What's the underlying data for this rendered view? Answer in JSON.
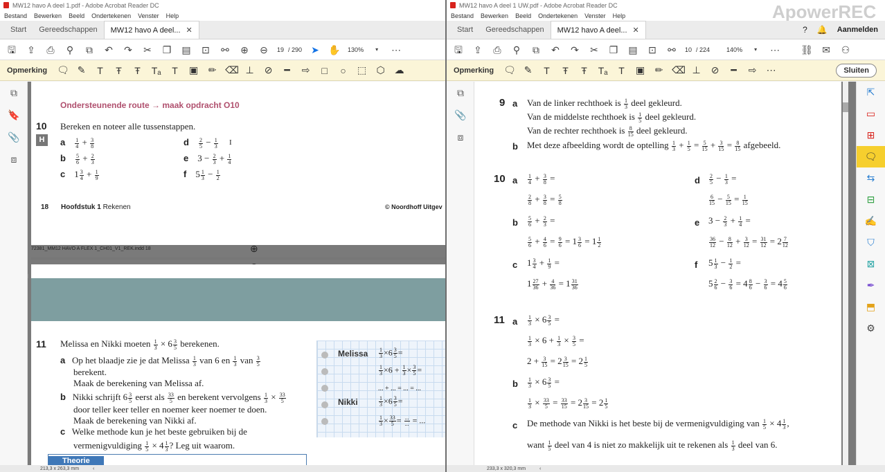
{
  "left": {
    "title": "MW12 havo A deel 1.pdf - Adobe Acrobat Reader DC",
    "menu": [
      "Bestand",
      "Bewerken",
      "Beeld",
      "Ondertekenen",
      "Venster",
      "Help"
    ],
    "tabs": {
      "start": "Start",
      "tools": "Gereedschappen",
      "doc": "MW12 havo A deel..."
    },
    "page_current": "19",
    "page_total": "/ 290",
    "zoom": "130%",
    "annot_label": "Opmerking",
    "status": "213,3 x 263,3 mm",
    "content": {
      "route": "Ondersteunende route → maak opdracht O10",
      "q10_num": "10",
      "q10_text": "Bereken en noteer alle tussenstappen.",
      "badge": "H",
      "a": "a",
      "b": "b",
      "c": "c",
      "d": "d",
      "e": "e",
      "f": "f",
      "footer_page": "18",
      "footer_chapter": "Hoofdstuk 1",
      "footer_chapter_rest": "Rekenen",
      "footer_copy": "© Noordhoff Uitgev",
      "printline": "72381_MM12 HAVO A FLEX 1_CH01_V1_REK.indd   18",
      "q11_num": "11",
      "q11_text_pre": "Melissa en Nikki moeten",
      "q11_text_post": "berekenen.",
      "q11a_1": "Op het blaadje zie je dat Melissa",
      "q11a_2": "van 6 en",
      "q11a_3": "van",
      "q11a_4": "berekent.",
      "q11a_5": "Maak de berekening van Melissa af.",
      "q11b_1": "Nikki schrijft",
      "q11b_2": "eerst als",
      "q11b_3": "en berekent vervolgens",
      "q11b_4": "door teller keer teller en noemer keer noemer te doen.",
      "q11b_5": "Maak de berekening van Nikki af.",
      "q11c_1": "Welke methode kun je het beste gebruiken bij de",
      "q11c_2": "vermenigvuldiging",
      "q11c_3": "? Leg uit waarom.",
      "note_melissa": "Melissa",
      "note_nikki": "Nikki",
      "note_dots": "... + ... = ... = ...",
      "theorie": "Theorie"
    }
  },
  "right": {
    "title": "MW12 havo A deel 1 UW.pdf - Adobe Acrobat Reader DC",
    "watermark": "ApowerREC",
    "menu": [
      "Bestand",
      "Bewerken",
      "Beeld",
      "Ondertekenen",
      "Venster",
      "Help"
    ],
    "tabs": {
      "start": "Start",
      "tools": "Gereedschappen",
      "doc": "MW12 havo A deel..."
    },
    "signin": "Aanmelden",
    "page_current": "10",
    "page_total": "/ 224",
    "zoom": "140%",
    "annot_label": "Opmerking",
    "close_label": "Sluiten",
    "status": "233,3 x 320,3 mm",
    "content": {
      "n9": "9",
      "n10": "10",
      "n11": "11",
      "a": "a",
      "b": "b",
      "c": "c",
      "d": "d",
      "e": "e",
      "f": "f",
      "s9a1_pre": "Van de linker rechthoek is",
      "s9a1_post": "deel gekleurd.",
      "s9a2_pre": "Van de middelste rechthoek is",
      "s9a2_post": "deel gekleurd.",
      "s9a3_pre": "Van de rechter rechthoek is",
      "s9a3_post": "deel gekleurd.",
      "s9b_pre": "Met deze afbeelding wordt de optelling",
      "s9b_post": "afgebeeld.",
      "s11c1_pre": "De methode van Nikki is het beste bij de vermenigvuldiging van",
      "s11c2_pre": "want",
      "s11c2_mid": "deel van 4 is niet zo makkelijk uit te rekenen als",
      "s11c2_post": "deel van 6."
    }
  }
}
